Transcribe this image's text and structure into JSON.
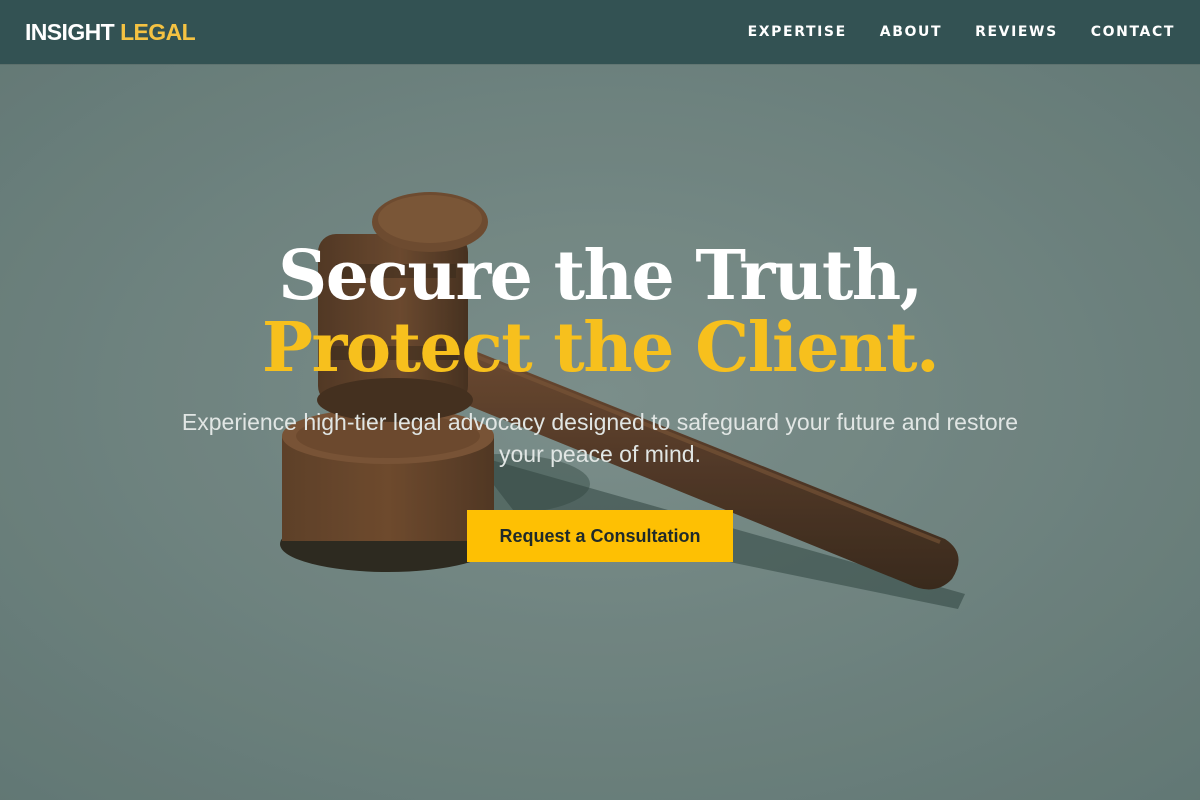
{
  "brand": {
    "name_part1": "INSIGHT",
    "name_part2": "LEGAL"
  },
  "nav": {
    "items": [
      {
        "label": "EXPERTISE"
      },
      {
        "label": "ABOUT"
      },
      {
        "label": "REVIEWS"
      },
      {
        "label": "CONTACT"
      }
    ]
  },
  "hero": {
    "headline_line1": "Secure the Truth,",
    "headline_line2": "Protect the Client.",
    "subtext": "Experience high-tier legal advocacy designed to safeguard your future and restore your peace of mind.",
    "cta_label": "Request a Consultation",
    "background_image": "gavel-photo"
  },
  "colors": {
    "nav_bg": "#335253",
    "accent": "#fec003",
    "hero_bg": "#84948f",
    "headline_white": "#ffffff",
    "headline_gold": "#f7c01d"
  }
}
